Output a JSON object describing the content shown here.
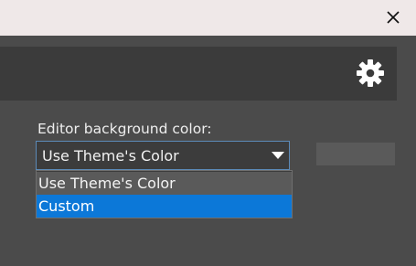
{
  "titlebar": {
    "close_icon": "close-icon"
  },
  "header": {
    "settings_icon": "gear-icon"
  },
  "editor": {
    "background_label": "Editor background color:",
    "select_value": "Use Theme's Color",
    "options": [
      "Use Theme's Color",
      "Custom"
    ],
    "highlighted_option": "Custom"
  },
  "colors": {
    "highlight": "#0c78d8",
    "select_border": "#5c8ab8",
    "panel_dark": "#3b3b3b",
    "panel": "#4b4b4b"
  }
}
